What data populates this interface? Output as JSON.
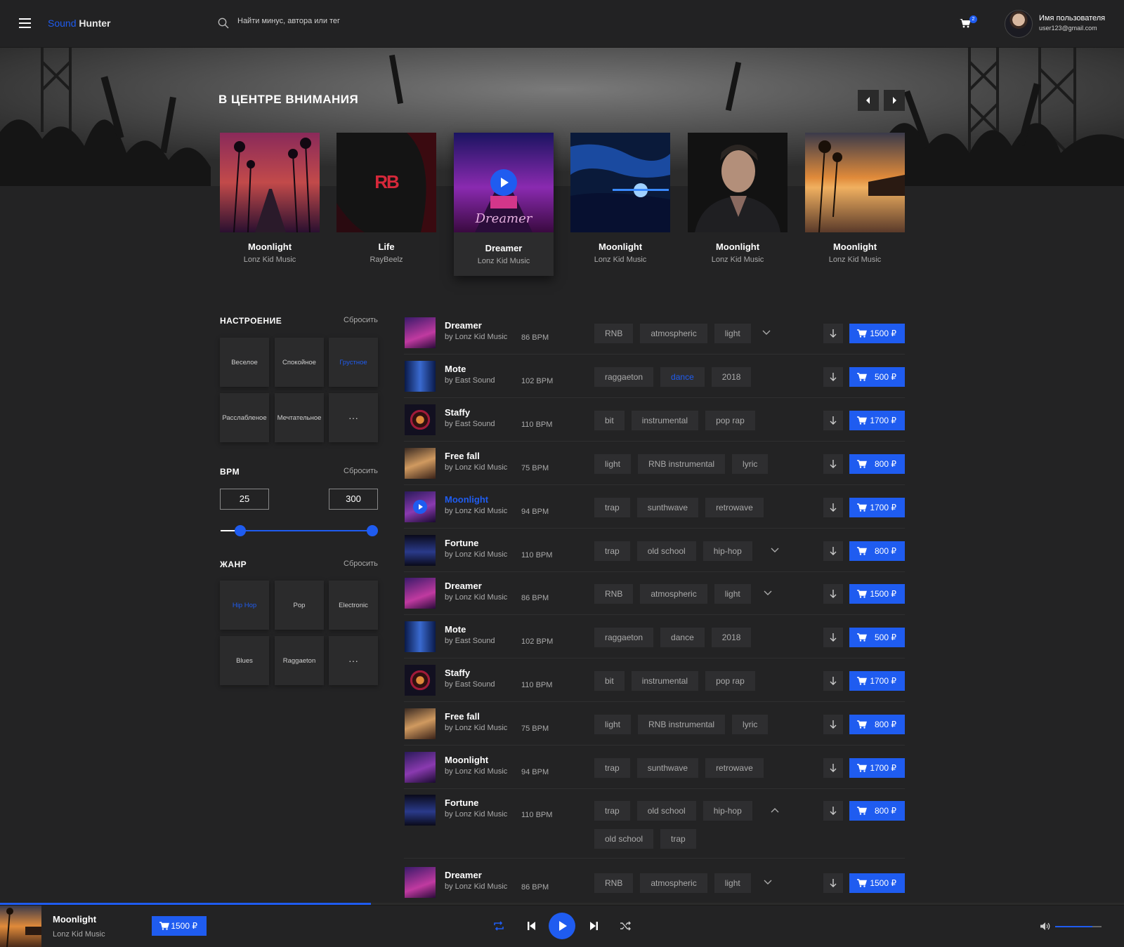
{
  "header": {
    "logo_a": "Sound",
    "logo_b": "Hunter",
    "search_placeholder": "Найти минус, автора или тег",
    "cart_count": "2",
    "user_name": "Имя пользователя",
    "user_email": "user123@gmail.com"
  },
  "spotlight": {
    "title": "В ЦЕНТРЕ ВНИМАНИЯ",
    "cards": [
      {
        "title": "Moonlight",
        "artist": "Lonz Kid Music"
      },
      {
        "title": "Life",
        "artist": "RayBeelz",
        "cover_text": "RB"
      },
      {
        "title": "Dreamer",
        "artist": "Lonz Kid Music",
        "cover_text": "Dreamer"
      },
      {
        "title": "Moonlight",
        "artist": "Lonz Kid Music"
      },
      {
        "title": "Moonlight",
        "artist": "Lonz Kid Music"
      },
      {
        "title": "Moonlight",
        "artist": "Lonz Kid Music"
      }
    ]
  },
  "filters": {
    "mood": {
      "title": "НАСТРОЕНИЕ",
      "reset": "Сбросить",
      "items": [
        "Веселое",
        "Спокойное",
        "Грустное",
        "Расслабленое",
        "Мечтательное",
        "···"
      ],
      "selected": "Грустное"
    },
    "bpm": {
      "title": "BPM",
      "reset": "Сбросить",
      "min": "25",
      "max": "300"
    },
    "genre": {
      "title": "ЖАНР",
      "reset": "Сбросить",
      "items": [
        "Hip Hop",
        "Pop",
        "Electronic",
        "Blues",
        "Raggaeton",
        "···"
      ],
      "selected": "Hip Hop"
    }
  },
  "tracks": [
    {
      "name": "Dreamer",
      "by": "by Lonz Kid Music",
      "bpm": "86 BPM",
      "tags": [
        "RNB",
        "atmospheric",
        "light"
      ],
      "price": "1500 ₽"
    },
    {
      "name": "Mote",
      "by": "by East Sound",
      "bpm": "102 BPM",
      "tags": [
        "raggaeton",
        "dance",
        "2018"
      ],
      "price": "500 ₽"
    },
    {
      "name": "Staffy",
      "by": "by East Sound",
      "bpm": "110 BPM",
      "tags": [
        "bit",
        "instrumental",
        "pop rap"
      ],
      "price": "1700 ₽"
    },
    {
      "name": "Free fall",
      "by": "by Lonz Kid Music",
      "bpm": "75 BPM",
      "tags": [
        "light",
        "RNB instrumental",
        "lyric"
      ],
      "price": "800 ₽"
    },
    {
      "name": "Moonlight",
      "by": "by Lonz Kid Music",
      "bpm": "94 BPM",
      "tags": [
        "trap",
        "sunthwave",
        "retrowave"
      ],
      "price": "1700 ₽"
    },
    {
      "name": "Fortune",
      "by": "by Lonz Kid Music",
      "bpm": "110 BPM",
      "tags": [
        "trap",
        "old school",
        "hip-hop"
      ],
      "price": "800 ₽"
    },
    {
      "name": "Dreamer",
      "by": "by Lonz Kid Music",
      "bpm": "86 BPM",
      "tags": [
        "RNB",
        "atmospheric",
        "light"
      ],
      "price": "1500 ₽"
    },
    {
      "name": "Mote",
      "by": "by East Sound",
      "bpm": "102 BPM",
      "tags": [
        "raggaeton",
        "dance",
        "2018"
      ],
      "price": "500 ₽"
    },
    {
      "name": "Staffy",
      "by": "by East Sound",
      "bpm": "110 BPM",
      "tags": [
        "bit",
        "instrumental",
        "pop rap"
      ],
      "price": "1700 ₽"
    },
    {
      "name": "Free fall",
      "by": "by Lonz Kid Music",
      "bpm": "75 BPM",
      "tags": [
        "light",
        "RNB instrumental",
        "lyric"
      ],
      "price": "800 ₽"
    },
    {
      "name": "Moonlight",
      "by": "by Lonz Kid Music",
      "bpm": "94 BPM",
      "tags": [
        "trap",
        "sunthwave",
        "retrowave"
      ],
      "price": "1700 ₽"
    },
    {
      "name": "Fortune",
      "by": "by Lonz Kid Music",
      "bpm": "110 BPM",
      "tags": [
        "trap",
        "old school",
        "hip-hop"
      ],
      "extra_tags": [
        "old school",
        "trap"
      ],
      "price": "800 ₽"
    },
    {
      "name": "Dreamer",
      "by": "by Lonz Kid Music",
      "bpm": "86 BPM",
      "tags": [
        "RNB",
        "atmospheric",
        "light"
      ],
      "price": "1500 ₽"
    }
  ],
  "player": {
    "title": "Moonlight",
    "artist": "Lonz Kid Music",
    "price": "1500 ₽",
    "progress": 0.33,
    "volume": 0.8
  },
  "colors": {
    "accent": "#1f5cf0",
    "bg": "#232324",
    "tag_bg": "#2e2e30"
  }
}
